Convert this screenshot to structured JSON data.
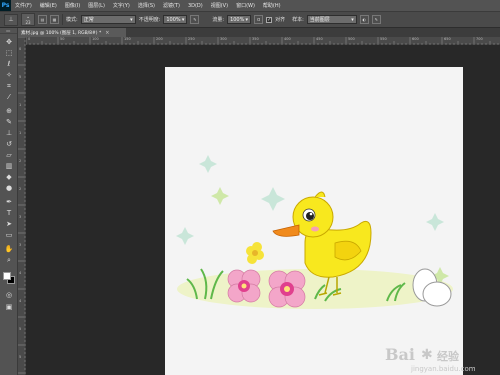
{
  "app": {
    "logo": "Ps"
  },
  "menu": [
    "文件(F)",
    "编辑(E)",
    "图像(I)",
    "图层(L)",
    "文字(Y)",
    "选择(S)",
    "滤镜(T)",
    "3D(D)",
    "视图(V)",
    "窗口(W)",
    "帮助(H)"
  ],
  "options": {
    "brush_size": "23",
    "mode_label": "模式:",
    "mode_value": "正常",
    "opacity_label": "不透明度:",
    "opacity_value": "100%",
    "flow_label": "流量:",
    "flow_value": "100%",
    "align_label": "对齐",
    "align_checked": true,
    "sample_label": "样本:",
    "sample_value": "当前图层"
  },
  "document": {
    "tab_label": "素材.jpg @ 100% (图层 1, RGB/8#) *",
    "close_glyph": "×"
  },
  "rulers": {
    "top": [
      "0",
      "50",
      "100",
      "150",
      "200",
      "250",
      "300",
      "350",
      "400",
      "450",
      "500",
      "550",
      "600",
      "650",
      "700"
    ],
    "left": [
      "0",
      "5",
      "1",
      "1",
      "2",
      "2",
      "3",
      "3",
      "4",
      "4",
      "5",
      "5"
    ]
  },
  "tools": [
    "move-icon",
    "marquee-icon",
    "lasso-icon",
    "quick-select-icon",
    "crop-icon",
    "eyedropper-icon",
    "healing-icon",
    "brush-icon",
    "clone-stamp-icon",
    "history-brush-icon",
    "eraser-icon",
    "gradient-icon",
    "blur-icon",
    "dodge-icon",
    "pen-icon",
    "type-icon",
    "path-select-icon",
    "shape-icon",
    "hand-icon",
    "zoom-icon"
  ],
  "colors": {
    "foreground": "#ffffff",
    "background": "#000000"
  },
  "watermark": {
    "brand": "Bai",
    "brand2": "经验",
    "url": "jingyan.baidu.com"
  }
}
